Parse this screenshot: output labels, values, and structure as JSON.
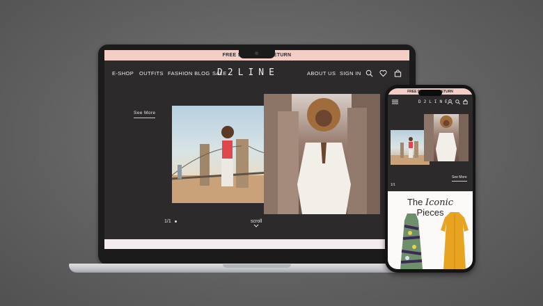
{
  "desktop": {
    "promo_text": "FREE SHIPPING & RETURN",
    "nav_left": [
      "E-SHOP",
      "OUTFITS",
      "FASHION BLOG",
      "SALE"
    ],
    "logo": "D2LINE",
    "nav_right": [
      "ABOUT US",
      "SIGN IN"
    ],
    "icons": [
      "search-icon",
      "heart-icon",
      "bag-icon"
    ],
    "hero": {
      "see_more": "See More",
      "pager": "1/1",
      "scroll": "scroll"
    }
  },
  "mobile": {
    "promo_text": "FREE SHIPPING & RETURN",
    "logo": "D2LINE",
    "icons": [
      "menu-icon",
      "user-icon",
      "search-icon",
      "bag-icon"
    ],
    "see_more": "See More",
    "pager": "1/1",
    "section_title_plain": "The",
    "section_title_italic": "Iconic",
    "section_title_line2": "Pieces"
  },
  "colors": {
    "background": "#2d2a2b",
    "promo_bar": "#f4cdc6",
    "text_light": "#f1eeee",
    "dress_yellow": "#e8a420"
  }
}
